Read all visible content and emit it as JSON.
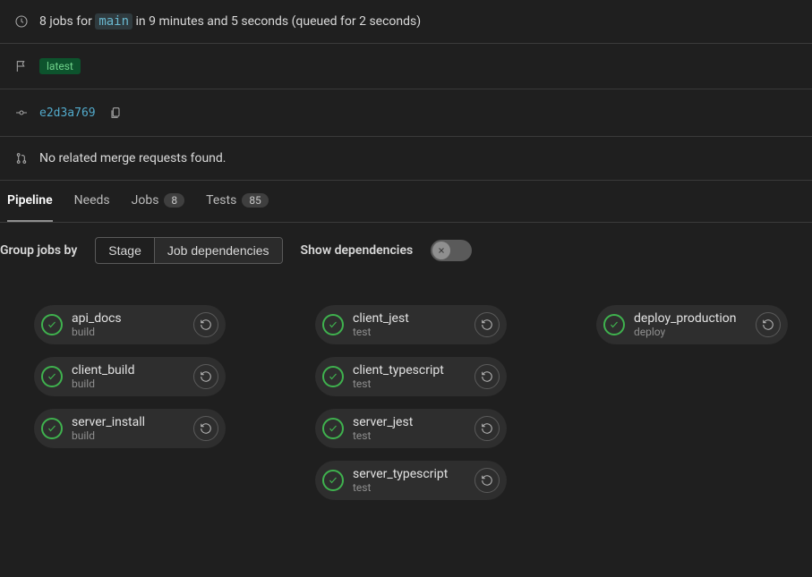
{
  "summary": {
    "jobs_prefix": "8 jobs for ",
    "branch": "main",
    "duration_text": " in 9 minutes and 5 seconds (queued for 2 seconds)"
  },
  "latest_badge": "latest",
  "commit": {
    "hash": "e2d3a769"
  },
  "merge_requests": {
    "text": "No related merge requests found."
  },
  "tabs": {
    "pipeline": "Pipeline",
    "needs": "Needs",
    "jobs_label": "Jobs",
    "jobs_count": "8",
    "tests_label": "Tests",
    "tests_count": "85"
  },
  "controls": {
    "group_label": "Group jobs by",
    "stage_btn": "Stage",
    "deps_btn": "Job dependencies",
    "show_deps_label": "Show dependencies"
  },
  "stages": [
    {
      "jobs": [
        {
          "name": "api_docs",
          "stage": "build"
        },
        {
          "name": "client_build",
          "stage": "build"
        },
        {
          "name": "server_install",
          "stage": "build"
        }
      ]
    },
    {
      "jobs": [
        {
          "name": "client_jest",
          "stage": "test"
        },
        {
          "name": "client_typescript",
          "stage": "test"
        },
        {
          "name": "server_jest",
          "stage": "test"
        },
        {
          "name": "server_typescript",
          "stage": "test"
        }
      ]
    },
    {
      "jobs": [
        {
          "name": "deploy_production",
          "stage": "deploy"
        }
      ]
    }
  ]
}
